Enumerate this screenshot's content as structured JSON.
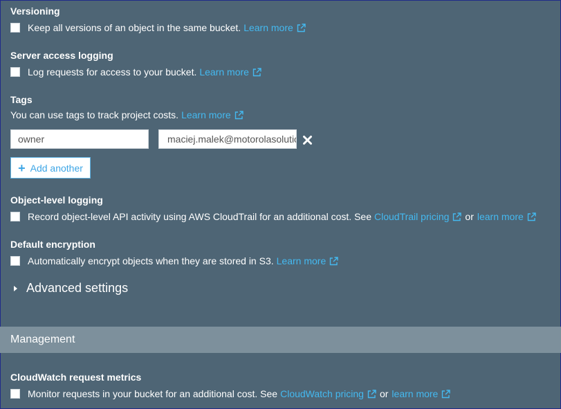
{
  "versioning": {
    "heading": "Versioning",
    "text": "Keep all versions of an object in the same bucket.",
    "link": "Learn more"
  },
  "server_access_logging": {
    "heading": "Server access logging",
    "text": "Log requests for access to your bucket.",
    "link": "Learn more"
  },
  "tags": {
    "heading": "Tags",
    "text": "You can use tags to track project costs.",
    "link": "Learn more",
    "key_value": "owner",
    "value_value": "maciej.malek@motorolasolutions.com",
    "add_label": "Add another"
  },
  "object_level_logging": {
    "heading": "Object-level logging",
    "text": "Record object-level API activity using AWS CloudTrail for an additional cost. See",
    "link1": "CloudTrail pricing",
    "or": "or",
    "link2": "learn more"
  },
  "default_encryption": {
    "heading": "Default encryption",
    "text": "Automatically encrypt objects when they are stored in S3.",
    "link": "Learn more"
  },
  "advanced": {
    "label": "Advanced settings"
  },
  "management": {
    "title": "Management"
  },
  "cloudwatch": {
    "heading": "CloudWatch request metrics",
    "text": "Monitor requests in your bucket for an additional cost. See",
    "link1": "CloudWatch pricing",
    "or": "or",
    "link2": "learn more"
  },
  "colors": {
    "background": "#4e6575",
    "section_bar": "#7d909c",
    "link": "#44b9f0",
    "button_text": "#3ea6e6"
  },
  "icons": {
    "external": "external-link-icon",
    "remove": "close-icon",
    "add": "plus-icon",
    "expand": "caret-right-icon"
  }
}
